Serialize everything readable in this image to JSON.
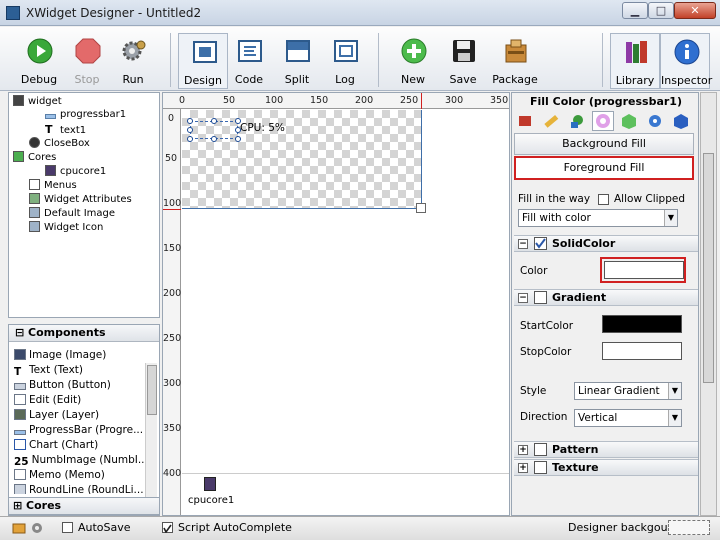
{
  "window": {
    "title": "XWidget Designer - Untitled2",
    "min": "▁",
    "max": "□",
    "close": "✕"
  },
  "toolbar": {
    "debug": "Debug",
    "stop": "Stop",
    "run": "Run",
    "design": "Design",
    "code": "Code",
    "split": "Split",
    "log": "Log",
    "new": "New",
    "save": "Save",
    "package": "Package",
    "library": "Library",
    "inspector": "Inspector"
  },
  "tree": {
    "widget": "widget",
    "progressbar1": "progressbar1",
    "text1": "text1",
    "closebox": "CloseBox",
    "cores": "Cores",
    "cpucore1": "cpucore1",
    "menus": "Menus",
    "attrs": "Widget Attributes",
    "default_image": "Default Image",
    "widget_icon": "Widget Icon"
  },
  "components": {
    "title": "Components",
    "items": [
      "Image (Image)",
      "Text (Text)",
      "Button (Button)",
      "Edit (Edit)",
      "Layer (Layer)",
      "ProgressBar (Progre...",
      "Chart (Chart)",
      "NumbImage (NumbI...",
      "Memo (Memo)",
      "RoundLine (RoundLi..."
    ],
    "numb_glyph": "25",
    "text_glyph": "T"
  },
  "cores_panel": {
    "title": "Cores"
  },
  "ruler": {
    "h": [
      "0",
      "50",
      "100",
      "150",
      "200",
      "250",
      "300",
      "350"
    ],
    "v": [
      "0",
      "50",
      "100",
      "150",
      "200",
      "250",
      "300",
      "350",
      "400"
    ]
  },
  "canvas": {
    "cpu_text": "CPU: 5%",
    "tray_item": "cpucore1"
  },
  "inspector": {
    "title": "Fill Color (progressbar1)",
    "background_fill": "Background Fill",
    "foreground_fill": "Foreground Fill",
    "fill_way_label": "Fill in the way",
    "allow_clipped": "Allow Clipped",
    "fill_way_value": "Fill with color",
    "solid_group": "SolidColor",
    "color_label": "Color",
    "gradient_group": "Gradient",
    "start_label": "StartColor",
    "stop_label": "StopColor",
    "style_label": "Style",
    "style_value": "Linear Gradient",
    "direction_label": "Direction",
    "direction_value": "Vertical",
    "pattern_group": "Pattern",
    "texture_group": "Texture"
  },
  "status": {
    "autosave": "AutoSave",
    "script_autocomplete": "Script AutoComplete",
    "designer_bg": "Designer backgound"
  },
  "colors": {
    "solid_color": "#ffffff",
    "start_color": "#000000",
    "stop_color": "#ffffff",
    "highlight": "#d02020"
  }
}
